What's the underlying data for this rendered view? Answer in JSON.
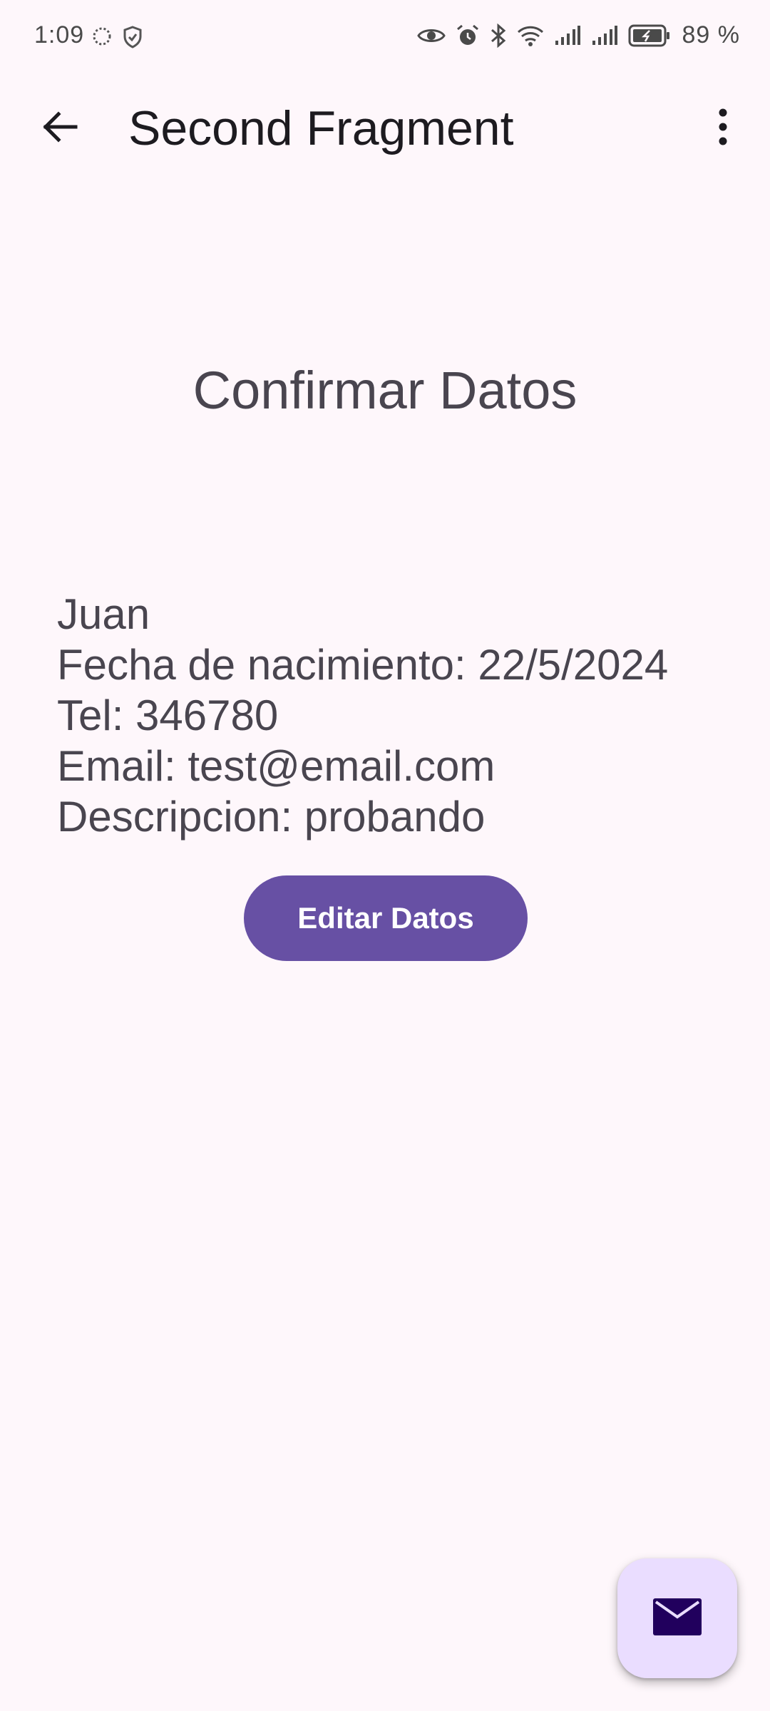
{
  "status_bar": {
    "time": "1:09",
    "battery": "89 %",
    "icons": [
      "loading-circle-icon",
      "shield-icon",
      "eye-icon",
      "alarm-icon",
      "bluetooth-icon",
      "wifi-icon",
      "signal-icon",
      "signal-icon",
      "battery-icon"
    ]
  },
  "app_bar": {
    "title": "Second Fragment",
    "back_icon": "arrow-back-icon",
    "overflow_icon": "more-vert-icon"
  },
  "content": {
    "heading": "Confirmar Datos",
    "name": "Juan",
    "birthdate": "Fecha de nacimiento: 22/5/2024",
    "phone": "Tel: 346780",
    "email": "Email: test@email.com",
    "description": "Descripcion: probando",
    "edit_button_label": "Editar Datos"
  },
  "fab": {
    "icon": "mail-icon"
  },
  "colors": {
    "background": "#fef7fb",
    "primary": "#6750a4",
    "fab_container": "#eaddff",
    "on_fab": "#21005d",
    "text_secondary": "#49454f"
  }
}
